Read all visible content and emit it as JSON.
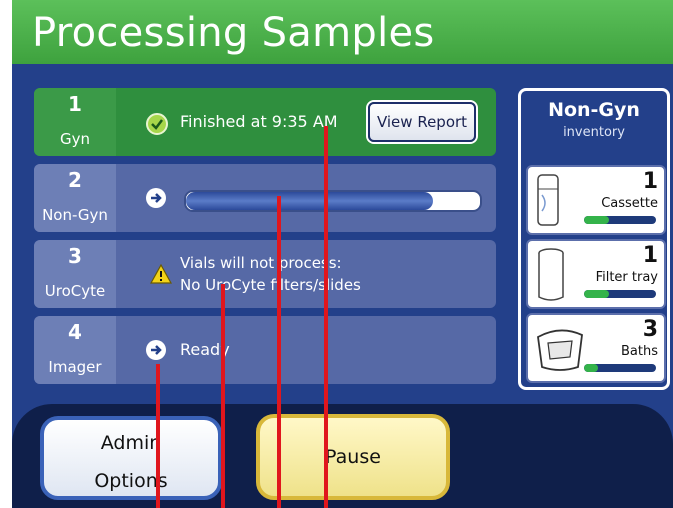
{
  "header": {
    "title": "Processing Samples"
  },
  "rows": [
    {
      "num": "1",
      "name": "Gyn",
      "status": "Finished at  9:35 AM",
      "button": "View Report"
    },
    {
      "num": "2",
      "name": "Non-Gyn",
      "progress": 0.84
    },
    {
      "num": "3",
      "name": "UroCyte",
      "warning_line1": "Vials will not process:",
      "warning_line2": "No UroCyte filters/slides"
    },
    {
      "num": "4",
      "name": "Imager",
      "status": "Ready"
    }
  ],
  "inventory": {
    "title": "Non-Gyn",
    "subtitle": "inventory",
    "items": [
      {
        "count": "1",
        "label": "Cassette",
        "level": 0.35,
        "icon": "cassette-icon"
      },
      {
        "count": "1",
        "label": "Filter tray",
        "level": 0.35,
        "icon": "filter-tray-icon"
      },
      {
        "count": "3",
        "label": "Baths",
        "level": 0.2,
        "icon": "baths-icon"
      }
    ]
  },
  "footer": {
    "admin_line1": "Admin",
    "admin_line2": "Options",
    "pause": "Pause"
  },
  "colors": {
    "header": "#48b048",
    "background": "#23408a",
    "row": "#5669a6",
    "row_done": "#2f8f3e",
    "annotation": "#e0161d"
  }
}
